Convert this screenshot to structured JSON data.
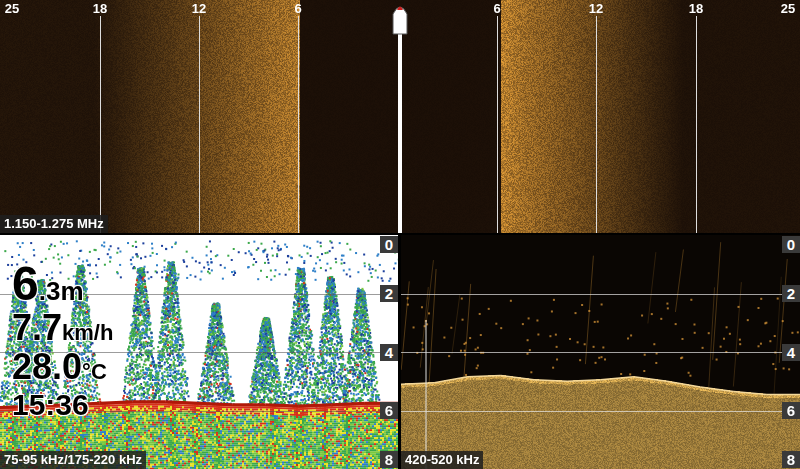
{
  "side_imaging": {
    "frequency": "1.150-1.275 MHz",
    "left_ranges": [
      "25",
      "18",
      "12",
      "6"
    ],
    "right_ranges": [
      "6",
      "12",
      "18",
      "25"
    ]
  },
  "sonar_2d": {
    "frequency": "75-95 kHz/175-220 kHz",
    "depth_scale": [
      "0",
      "2",
      "4",
      "6",
      "8"
    ],
    "readouts": [
      {
        "kind": "value",
        "main": "6",
        "unit": ".3m"
      },
      {
        "kind": "value",
        "main": "7.7",
        "unit": "km/h"
      },
      {
        "kind": "value",
        "main": "28.0",
        "unit": "°C"
      },
      {
        "kind": "clock",
        "main": "15:36"
      }
    ],
    "bottom_depth": [
      5.9,
      5.85,
      5.8,
      5.75,
      5.7,
      5.7,
      5.75,
      5.8,
      5.8,
      5.85,
      5.8,
      5.75,
      5.75
    ]
  },
  "down_imaging": {
    "frequency": "420-520 kHz",
    "depth_scale": [
      "0",
      "2",
      "4",
      "6",
      "8"
    ],
    "bottom_depth": [
      5.1,
      5.05,
      4.85,
      4.8,
      4.95,
      5.0,
      4.95,
      4.85,
      5.0,
      5.2,
      5.35,
      5.45,
      5.45
    ]
  }
}
